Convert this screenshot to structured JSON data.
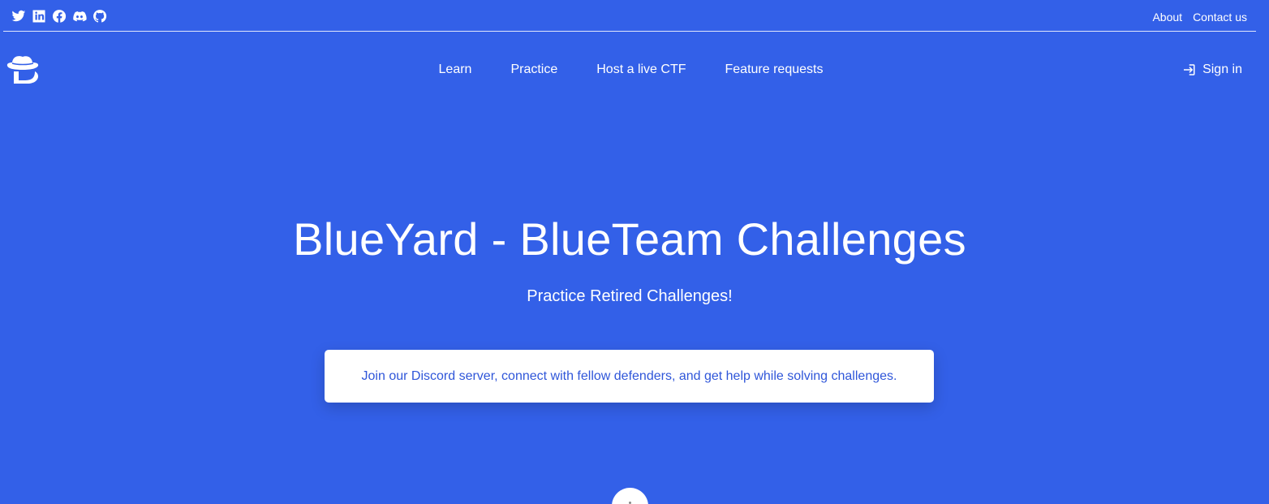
{
  "topbar": {
    "social_icons": [
      "twitter-icon",
      "linkedin-icon",
      "facebook-icon",
      "discord-icon",
      "github-icon"
    ],
    "links": {
      "about": "About",
      "contact": "Contact us"
    }
  },
  "logo": {
    "icon": "hat-logo-icon"
  },
  "nav": {
    "items": [
      {
        "label": "Learn"
      },
      {
        "label": "Practice"
      },
      {
        "label": "Host a live CTF"
      },
      {
        "label": "Feature requests"
      }
    ],
    "signin_label": "Sign in",
    "signin_icon": "sign-in-icon"
  },
  "hero": {
    "title": "BlueYard - BlueTeam Challenges",
    "subtitle": "Practice Retired Challenges!",
    "banner_text": "Join our Discord server, connect with fellow defenders, and get help while solving challenges."
  },
  "colors": {
    "background": "#3360e8",
    "banner_text": "#2f56d9",
    "foreground": "#ffffff"
  }
}
